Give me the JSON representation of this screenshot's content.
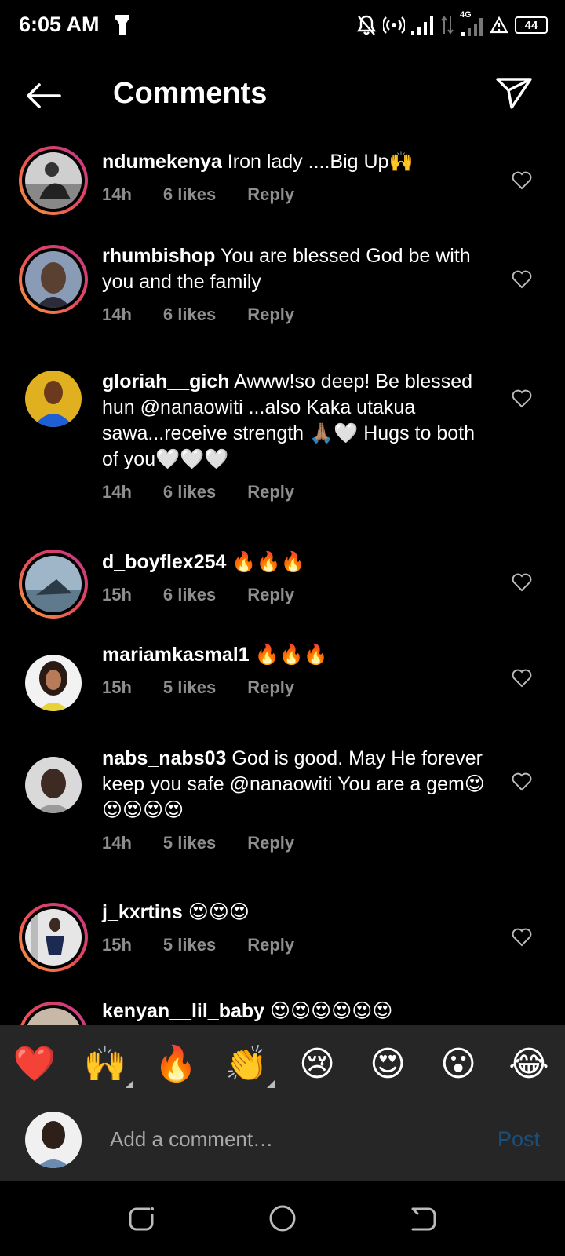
{
  "status": {
    "time": "6:05 AM",
    "network": "4G",
    "battery": "44"
  },
  "header": {
    "title": "Comments"
  },
  "comments": [
    {
      "username": "ndumekenya",
      "text": "Iron lady ....Big Up🙌",
      "time": "14h",
      "likes": "6 likes",
      "reply": "Reply"
    },
    {
      "username": "rhumbishop",
      "text": "You are blessed God be with you and the family",
      "time": "14h",
      "likes": "6 likes",
      "reply": "Reply"
    },
    {
      "username": "gloriah__gich",
      "text": "Awww!so deep! Be blessed hun @nanaowiti ...also Kaka utakua sawa...receive strength 🙏🏽🤍 Hugs to  both of you🤍🤍🤍",
      "time": "14h",
      "likes": "6 likes",
      "reply": "Reply"
    },
    {
      "username": "d_boyflex254",
      "text": "🔥🔥🔥",
      "time": "15h",
      "likes": "6 likes",
      "reply": "Reply"
    },
    {
      "username": "mariamkasmal1",
      "text": "🔥🔥🔥",
      "time": "15h",
      "likes": "5 likes",
      "reply": "Reply"
    },
    {
      "username": "nabs_nabs03",
      "text": "God is good. May He forever keep you safe @nanaowiti  You are a gem😍😍😍😍😍",
      "time": "14h",
      "likes": "5 likes",
      "reply": "Reply"
    },
    {
      "username": "j_kxrtins",
      "text": "😍😍😍",
      "time": "15h",
      "likes": "5 likes",
      "reply": "Reply"
    },
    {
      "username": "kenyan__lil_baby",
      "text": "😍😍😍😍😍😍",
      "time": "",
      "likes": "",
      "reply": ""
    }
  ],
  "emoji_bar": [
    "❤️",
    "🙌",
    "🔥",
    "👏",
    "😢",
    "😍",
    "😮",
    "😂"
  ],
  "composer": {
    "placeholder": "Add a comment…",
    "post_label": "Post"
  },
  "colors": {
    "background": "#000000",
    "composer_bg": "#262626",
    "meta_text": "#8e8e8e",
    "post_disabled": "#1a4f7a"
  }
}
